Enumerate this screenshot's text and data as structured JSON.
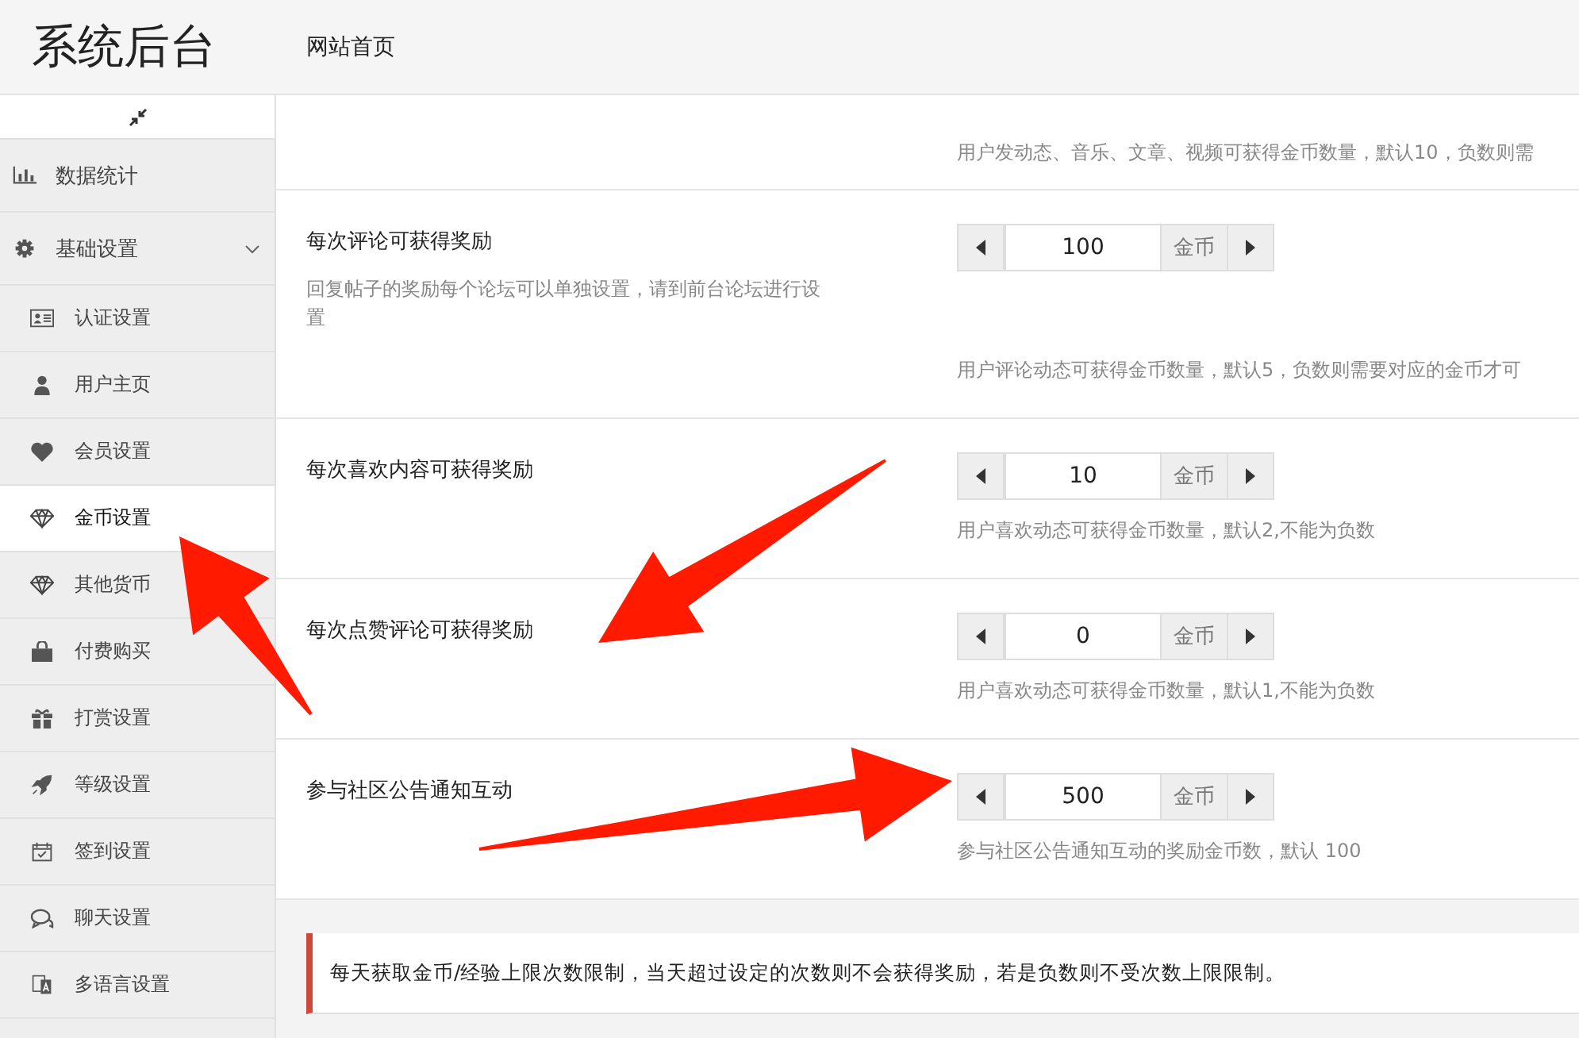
{
  "header": {
    "logo": "系统后台",
    "nav": [
      {
        "label": "网站首页"
      }
    ]
  },
  "sidebar": {
    "items": [
      {
        "label": "数据统计",
        "selected": false
      },
      {
        "label": "基础设置",
        "selected": false,
        "expanded": true,
        "children": [
          {
            "label": "认证设置",
            "selected": false
          },
          {
            "label": "用户主页",
            "selected": false
          },
          {
            "label": "会员设置",
            "selected": false
          },
          {
            "label": "金币设置",
            "selected": true
          },
          {
            "label": "其他货币",
            "selected": false
          },
          {
            "label": "付费购买",
            "selected": false
          },
          {
            "label": "打赏设置",
            "selected": false
          },
          {
            "label": "等级设置",
            "selected": false
          },
          {
            "label": "签到设置",
            "selected": false
          },
          {
            "label": "聊天设置",
            "selected": false
          },
          {
            "label": "多语言设置",
            "selected": false
          }
        ]
      }
    ]
  },
  "settings": [
    {
      "description": "用户发动态、音乐、文章、视频可获得金币数量，默认10，负数则需"
    },
    {
      "title": "每次评论可获得奖励",
      "hint": "回复帖子的奖励每个论坛可以单独设置，请到前台论坛进行设置",
      "value": "100",
      "unit": "金币",
      "description": "用户评论动态可获得金币数量，默认5，负数则需要对应的金币才可"
    },
    {
      "title": "每次喜欢内容可获得奖励",
      "value": "10",
      "unit": "金币",
      "description": "用户喜欢动态可获得金币数量，默认2,不能为负数"
    },
    {
      "title": "每次点赞评论可获得奖励",
      "value": "0",
      "unit": "金币",
      "description": "用户喜欢动态可获得金币数量，默认1,不能为负数"
    },
    {
      "title": "参与社区公告通知互动",
      "value": "500",
      "unit": "金币",
      "description": "参与社区公告通知互动的奖励金币数，默认 100"
    }
  ],
  "notice": "每天获取金币/经验上限次数限制，当天超过设定的次数则不会获得奖励，若是负数则不受次数上限限制。"
}
